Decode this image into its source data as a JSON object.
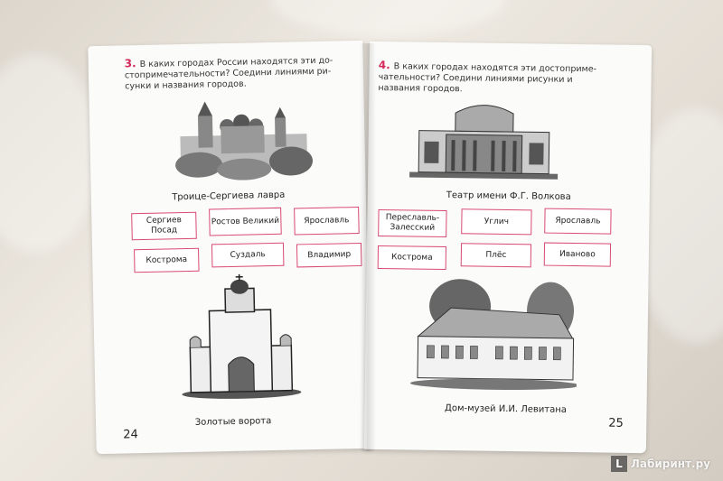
{
  "left_page": {
    "task": {
      "number": "3.",
      "text": "В каких городах России находятся эти до- стопримечательности? Соедини линиями ри- сунки и названия городов."
    },
    "caption_top": "Троице-Сергиева лавра",
    "cities": [
      "Сергиев Посад",
      "Ростов Великий",
      "Ярославль",
      "Кострома",
      "Суздаль",
      "Владимир"
    ],
    "caption_bottom": "Золотые ворота",
    "page_number": "24"
  },
  "right_page": {
    "task": {
      "number": "4.",
      "text": "В каких городах находятся эти достоприме- чательности? Соедини линиями рисунки и названия городов."
    },
    "caption_top": "Театр имени Ф.Г. Волкова",
    "cities": [
      "Переславль-Залесский",
      "Углич",
      "Ярославль",
      "Кострома",
      "Плёс",
      "Иваново"
    ],
    "caption_bottom": "Дом-музей И.И. Левитана",
    "page_number": "25"
  },
  "watermark": {
    "icon": "L",
    "text": "Лабиринт.ру"
  },
  "colors": {
    "accent": "#d84a72",
    "task_number": "#d42a5a"
  }
}
